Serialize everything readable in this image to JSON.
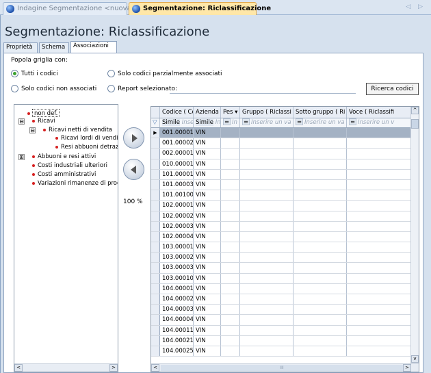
{
  "doc_tabs": {
    "inactive": "Indagine Segmentazione <nuova>",
    "active": "Segmentazione: Riclassificazione",
    "arrows": "◁ ▷"
  },
  "page_title": "Segmentazione: Riclassificazione",
  "sub_tabs": [
    "Proprietà",
    "Schema",
    "Associazioni"
  ],
  "popola_label": "Popola griglia con:",
  "options": {
    "tutti": "Tutti i codici",
    "parziali": "Solo codici parzialmente associati",
    "non_associati": "Solo codici non associati",
    "report": "Report selezionato:"
  },
  "selected_option": "tutti",
  "ricerca_button": "Ricerca codici",
  "tree": {
    "nodes": [
      "non def.",
      "Ricavi",
      "Ricavi netti di vendita",
      "Ricavi lordi di vendi",
      "Resi abbuoni detraz",
      "Abbuoni e resi attivi",
      "Costi industriali ulteriori",
      "Costi amministrativi",
      "Variazioni rimanenze di proc"
    ],
    "pm": [
      "⊟",
      "⊟",
      "⊞"
    ]
  },
  "percent_label": "100  %",
  "grid": {
    "headers": [
      "Codice ( Cont",
      "Azienda (",
      "Pes ▾",
      "Gruppo ( Riclassi",
      "Sotto gruppo ( Ri",
      "Voce ( Riclassifi"
    ],
    "filter": {
      "codice_op": "Simile",
      "codice_ph": "Inserir",
      "azienda_op": "Simile",
      "azienda_ph": "Inse",
      "pes_op": "=",
      "pes_ph": "In",
      "gruppo_ph": "Inserire un va",
      "sotto_ph": "Inserire un va",
      "voce_ph": "Inserire un v"
    },
    "rows": [
      {
        "codice": "001.00001",
        "azienda": "VIN"
      },
      {
        "codice": "001.00002",
        "azienda": "VIN"
      },
      {
        "codice": "002.00001",
        "azienda": "VIN"
      },
      {
        "codice": "010.00001",
        "azienda": "VIN"
      },
      {
        "codice": "101.00001",
        "azienda": "VIN"
      },
      {
        "codice": "101.00003",
        "azienda": "VIN"
      },
      {
        "codice": "101.00100",
        "azienda": "VIN"
      },
      {
        "codice": "102.00001",
        "azienda": "VIN"
      },
      {
        "codice": "102.00002",
        "azienda": "VIN"
      },
      {
        "codice": "102.00003",
        "azienda": "VIN"
      },
      {
        "codice": "102.00004",
        "azienda": "VIN"
      },
      {
        "codice": "103.00001",
        "azienda": "VIN"
      },
      {
        "codice": "103.00002",
        "azienda": "VIN"
      },
      {
        "codice": "103.00003",
        "azienda": "VIN"
      },
      {
        "codice": "103.00010",
        "azienda": "VIN"
      },
      {
        "codice": "104.00001",
        "azienda": "VIN"
      },
      {
        "codice": "104.00002",
        "azienda": "VIN"
      },
      {
        "codice": "104.00003",
        "azienda": "VIN"
      },
      {
        "codice": "104.00004",
        "azienda": "VIN"
      },
      {
        "codice": "104.00011",
        "azienda": "VIN"
      },
      {
        "codice": "104.00021",
        "azienda": "VIN"
      },
      {
        "codice": "104.00025",
        "azienda": "VIN"
      }
    ],
    "scroll_thumb": "III"
  },
  "colors": {
    "selected_row": "#a4b2c4",
    "active_tab": "#ffe7a8",
    "radio_on": "#3ba22f",
    "tree_dot": "#d62020"
  }
}
